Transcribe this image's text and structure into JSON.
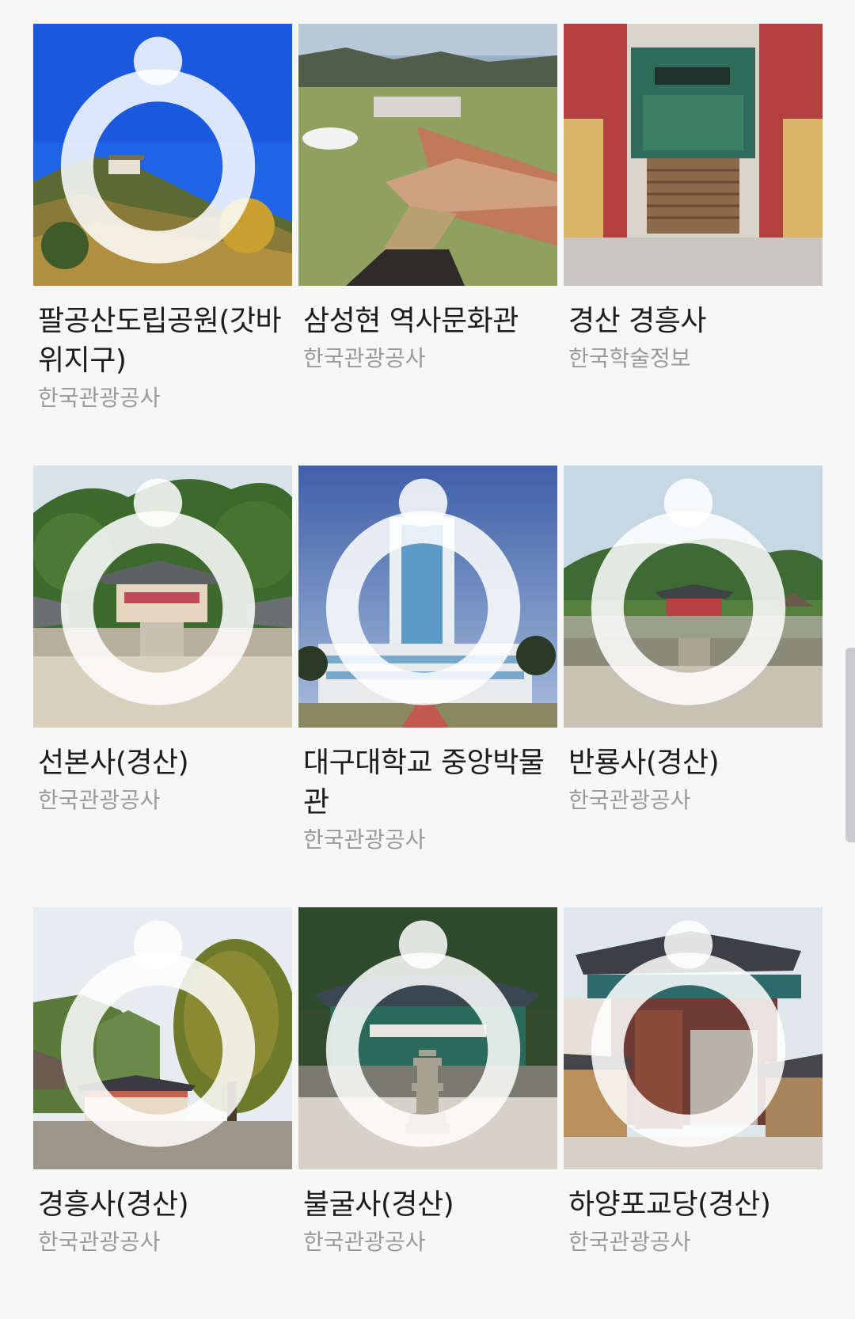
{
  "places": [
    {
      "title": "팔공산도립공원(갓바위지구)",
      "source": "한국관광공사",
      "image": "mountain-ridge-photo",
      "watermark": true
    },
    {
      "title": "삼성현 역사문화관",
      "source": "한국관광공사",
      "image": "museum-park-photo",
      "watermark": false
    },
    {
      "title": "경산 경흥사",
      "source": "한국학술정보",
      "image": "temple-gate-stairs-photo",
      "watermark": false
    },
    {
      "title": "선본사(경산)",
      "source": "한국관광공사",
      "image": "temple-courtyard-photo",
      "watermark": true
    },
    {
      "title": "대구대학교 중앙박물관",
      "source": "한국관광공사",
      "image": "university-tower-photo",
      "watermark": true
    },
    {
      "title": "반룡사(경산)",
      "source": "한국관광공사",
      "image": "temple-hillside-photo",
      "watermark": true
    },
    {
      "title": "경흥사(경산)",
      "source": "한국관광공사",
      "image": "temple-ginkgo-tree-photo",
      "watermark": true
    },
    {
      "title": "불굴사(경산)",
      "source": "한국관광공사",
      "image": "temple-pagoda-photo",
      "watermark": true
    },
    {
      "title": "하양포교당(경산)",
      "source": "한국관광공사",
      "image": "hanok-gate-photo",
      "watermark": true
    }
  ],
  "colors": {
    "background": "#f7f7f8",
    "title": "#1d1d1d",
    "source": "#9a9a9a"
  }
}
